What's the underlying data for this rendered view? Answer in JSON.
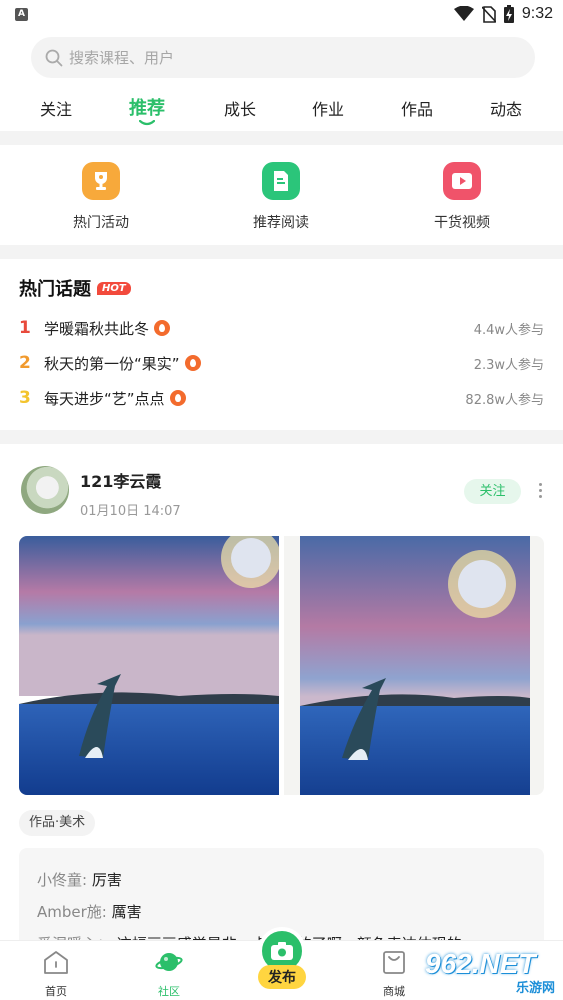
{
  "status_bar": {
    "app_indicator": "A",
    "time": "9:32",
    "icons": [
      "wifi-icon",
      "no-sim-icon",
      "battery-charging-icon"
    ]
  },
  "search": {
    "placeholder": "搜索课程、用户",
    "icon": "search-icon"
  },
  "tabs": [
    {
      "label": "关注",
      "active": false
    },
    {
      "label": "推荐",
      "active": true
    },
    {
      "label": "成长",
      "active": false
    },
    {
      "label": "作业",
      "active": false
    },
    {
      "label": "作品",
      "active": false
    },
    {
      "label": "动态",
      "active": false
    }
  ],
  "features": [
    {
      "label": "热门活动",
      "icon": "trophy-icon",
      "color": "#f7a93b"
    },
    {
      "label": "推荐阅读",
      "icon": "document-icon",
      "color": "#2bc57a"
    },
    {
      "label": "干货视频",
      "icon": "play-video-icon",
      "color": "#f0536a"
    }
  ],
  "hot_topics": {
    "title": "热门话题",
    "badge": "HOT",
    "items": [
      {
        "rank": "1",
        "title": "学暖霜秋共此冬",
        "count": "4.4w人参与",
        "rank_color": "#e84a3c"
      },
      {
        "rank": "2",
        "title": "秋天的第一份“果实”",
        "count": "2.3w人参与",
        "rank_color": "#f19a2e"
      },
      {
        "rank": "3",
        "title": "每天进步“艺”点点",
        "count": "82.8w人参与",
        "rank_color": "#f3c42e"
      }
    ]
  },
  "post": {
    "username": "121李云霞",
    "time": "01月10日  14:07",
    "follow_label": "关注",
    "tag": "作品·美术",
    "comments": [
      {
        "user": "小佟童:",
        "text": "厉害"
      },
      {
        "user": "Amber施:",
        "text": "厲害"
      },
      {
        "user": "爱涅暖心：",
        "text": "这幅画画感觉是非一点功底的了啊，颜色表达体现的"
      }
    ]
  },
  "bottom_nav": {
    "items": [
      {
        "label": "首页",
        "icon": "home-icon",
        "active": false
      },
      {
        "label": "社区",
        "icon": "community-planet-icon",
        "active": true
      },
      {
        "label": "商城",
        "icon": "shopping-bag-icon",
        "active": false
      }
    ],
    "publish_label": "发布"
  },
  "watermark": {
    "main": "962.NET",
    "sub": "乐游网"
  }
}
